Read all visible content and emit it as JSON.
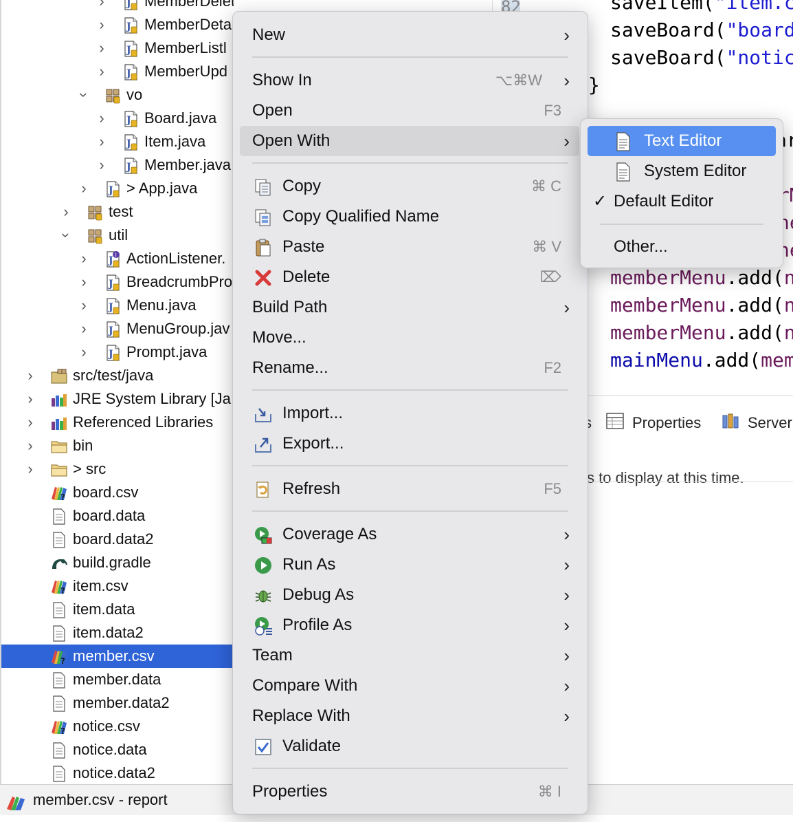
{
  "tree": {
    "rows": [
      {
        "label": "MemberDeleteListener.java",
        "type": "java",
        "indent": 2,
        "expand": "closed"
      },
      {
        "label": "MemberDeta",
        "type": "java",
        "indent": 2,
        "expand": "closed"
      },
      {
        "label": "MemberListl",
        "type": "java",
        "indent": 2,
        "expand": "closed"
      },
      {
        "label": "MemberUpd",
        "type": "java",
        "indent": 2,
        "expand": "closed"
      },
      {
        "label": "vo",
        "type": "package",
        "indent": 1,
        "expand": "open"
      },
      {
        "label": "Board.java",
        "type": "java",
        "indent": 2,
        "expand": "closed"
      },
      {
        "label": "Item.java",
        "type": "java",
        "indent": 2,
        "expand": "closed"
      },
      {
        "label": "Member.java",
        "type": "java",
        "indent": 2,
        "expand": "closed"
      },
      {
        "label": "> App.java",
        "type": "java",
        "indent": 1,
        "expand": "closed"
      },
      {
        "label": "test",
        "type": "package",
        "indent": 0,
        "expand": "closed"
      },
      {
        "label": "util",
        "type": "package",
        "indent": 0,
        "expand": "open"
      },
      {
        "label": "ActionListener.",
        "type": "interface",
        "indent": 1,
        "expand": "closed"
      },
      {
        "label": "BreadcrumbPro",
        "type": "java",
        "indent": 1,
        "expand": "closed"
      },
      {
        "label": "Menu.java",
        "type": "java",
        "indent": 1,
        "expand": "closed"
      },
      {
        "label": "MenuGroup.jav",
        "type": "java",
        "indent": 1,
        "expand": "closed"
      },
      {
        "label": "Prompt.java",
        "type": "java",
        "indent": 1,
        "expand": "closed"
      },
      {
        "label": "src/test/java",
        "type": "srcfolder",
        "indent": -2,
        "expand": "closed"
      },
      {
        "label": "JRE System Library [Ja",
        "type": "library",
        "indent": -2,
        "expand": "closed"
      },
      {
        "label": "Referenced Libraries",
        "type": "library",
        "indent": -2,
        "expand": "closed"
      },
      {
        "label": "bin",
        "type": "folder",
        "indent": -2,
        "expand": "closed"
      },
      {
        "label": "> src",
        "type": "folder",
        "indent": -2,
        "expand": "closed"
      },
      {
        "label": "board.csv",
        "type": "csv",
        "indent": -2,
        "expand": "none"
      },
      {
        "label": "board.data",
        "type": "file",
        "indent": -2,
        "expand": "none"
      },
      {
        "label": "board.data2",
        "type": "file",
        "indent": -2,
        "expand": "none"
      },
      {
        "label": "build.gradle",
        "type": "gradle",
        "indent": -2,
        "expand": "none"
      },
      {
        "label": "item.csv",
        "type": "csv",
        "indent": -2,
        "expand": "none"
      },
      {
        "label": "item.data",
        "type": "file",
        "indent": -2,
        "expand": "none"
      },
      {
        "label": "item.data2",
        "type": "file",
        "indent": -2,
        "expand": "none"
      },
      {
        "label": "member.csv",
        "type": "csv",
        "indent": -2,
        "expand": "none",
        "selected": true
      },
      {
        "label": "member.data",
        "type": "file",
        "indent": -2,
        "expand": "none"
      },
      {
        "label": "member.data2",
        "type": "file",
        "indent": -2,
        "expand": "none"
      },
      {
        "label": "notice.csv",
        "type": "csv",
        "indent": -2,
        "expand": "none"
      },
      {
        "label": "notice.data",
        "type": "file",
        "indent": -2,
        "expand": "none"
      },
      {
        "label": "notice.data2",
        "type": "file",
        "indent": -2,
        "expand": "none"
      }
    ]
  },
  "editor": {
    "line_number": "82",
    "code_lines": [
      {
        "parts": [
          {
            "t": "saveItem(",
            "c": "plain"
          },
          {
            "t": "\"item.cs",
            "c": "str"
          }
        ]
      },
      {
        "parts": [
          {
            "t": "saveBoard(",
            "c": "plain"
          },
          {
            "t": "\"board.",
            "c": "str"
          }
        ]
      },
      {
        "parts": [
          {
            "t": "saveBoard(",
            "c": "plain"
          },
          {
            "t": "\"notice",
            "c": "str"
          }
        ]
      },
      {
        "parts": [
          {
            "t": "}",
            "c": "plain"
          }
        ]
      },
      {
        "parts": [
          {
            "t": "ar",
            "c": "plain"
          }
        ]
      },
      {
        "parts": [
          {
            "t": "rM",
            "c": "var"
          }
        ]
      },
      {
        "parts": [
          {
            "t": "ne",
            "c": "var"
          }
        ]
      },
      {
        "parts": [
          {
            "t": "ne",
            "c": "var"
          }
        ]
      },
      {
        "parts": [
          {
            "t": "memberMenu",
            "c": "var"
          },
          {
            "t": ".add(",
            "c": "plain"
          },
          {
            "t": "ne",
            "c": "var"
          }
        ]
      },
      {
        "parts": [
          {
            "t": "memberMenu",
            "c": "var"
          },
          {
            "t": ".add(",
            "c": "plain"
          },
          {
            "t": "ne",
            "c": "var"
          }
        ]
      },
      {
        "parts": [
          {
            "t": "memberMenu",
            "c": "var"
          },
          {
            "t": ".add(",
            "c": "plain"
          },
          {
            "t": "ne",
            "c": "var"
          }
        ]
      },
      {
        "parts": [
          {
            "t": "mainMenu",
            "c": "field"
          },
          {
            "t": ".add(",
            "c": "plain"
          },
          {
            "t": "memb",
            "c": "var"
          }
        ]
      }
    ]
  },
  "panel": {
    "tab_partial": "s",
    "tab_properties": "Properties",
    "tab_servers": "Server",
    "message": "s to display at this time."
  },
  "statusbar": {
    "text": "member.csv - report"
  },
  "context_menu": {
    "items": [
      {
        "label": "New",
        "arrow": true
      },
      {
        "sep": true
      },
      {
        "label": "Show In",
        "shortcut": "⌥⌘W",
        "arrow": true
      },
      {
        "label": "Open",
        "shortcut": "F3"
      },
      {
        "label": "Open With",
        "arrow": true,
        "highlight": true
      },
      {
        "sep": true
      },
      {
        "label": "Copy",
        "shortcut": "⌘ C",
        "icon": "copy-icon"
      },
      {
        "label": "Copy Qualified Name",
        "icon": "copy-qualified-icon"
      },
      {
        "label": "Paste",
        "shortcut": "⌘ V",
        "icon": "paste-icon"
      },
      {
        "label": "Delete",
        "shortcut": "⌦",
        "icon": "delete-icon"
      },
      {
        "label": "Build Path",
        "arrow": true
      },
      {
        "label": "Move..."
      },
      {
        "label": "Rename...",
        "shortcut": "F2"
      },
      {
        "sep": true
      },
      {
        "label": "Import...",
        "icon": "import-icon"
      },
      {
        "label": "Export...",
        "icon": "export-icon"
      },
      {
        "sep": true
      },
      {
        "label": "Refresh",
        "shortcut": "F5",
        "icon": "refresh-icon"
      },
      {
        "sep": true
      },
      {
        "label": "Coverage As",
        "arrow": true,
        "icon": "coverage-icon"
      },
      {
        "label": "Run As",
        "arrow": true,
        "icon": "run-icon"
      },
      {
        "label": "Debug As",
        "arrow": true,
        "icon": "debug-icon"
      },
      {
        "label": "Profile As",
        "arrow": true,
        "icon": "profile-icon"
      },
      {
        "label": "Team",
        "arrow": true
      },
      {
        "label": "Compare With",
        "arrow": true
      },
      {
        "label": "Replace With",
        "arrow": true
      },
      {
        "label": "Validate",
        "icon": "validate-icon"
      },
      {
        "sep": true
      },
      {
        "label": "Properties",
        "shortcut": "⌘ I"
      }
    ]
  },
  "submenu": {
    "items": [
      {
        "label": "Text Editor",
        "icon": "text-editor-icon",
        "highlight": true
      },
      {
        "label": "System Editor",
        "icon": "system-editor-icon"
      },
      {
        "label": "Default Editor",
        "check": "✓"
      },
      {
        "sep": true
      },
      {
        "label": "Other..."
      }
    ]
  },
  "colors": {
    "selection": "#2f63d8",
    "submenu_highlight": "#5790f0",
    "menu_bg": "#e8e7ea"
  }
}
